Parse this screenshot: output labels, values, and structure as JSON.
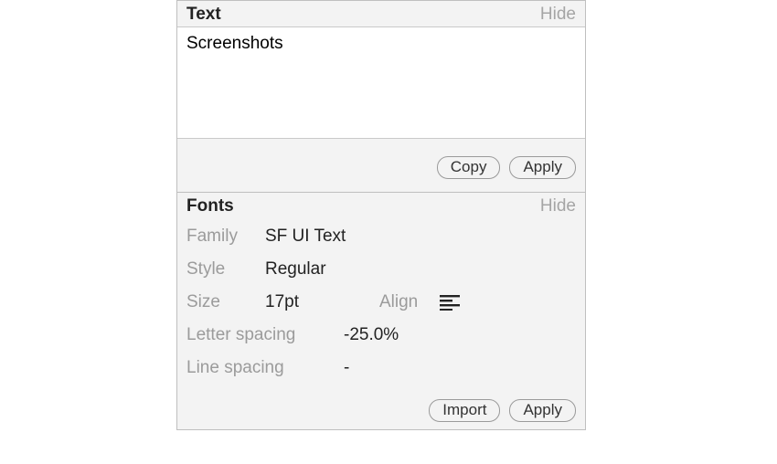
{
  "text_panel": {
    "title": "Text",
    "hide": "Hide",
    "value": "Screenshots",
    "copy_label": "Copy",
    "apply_label": "Apply"
  },
  "fonts_panel": {
    "title": "Fonts",
    "hide": "Hide",
    "family_label": "Family",
    "family_value": "SF UI Text",
    "style_label": "Style",
    "style_value": "Regular",
    "size_label": "Size",
    "size_value": "17pt",
    "align_label": "Align",
    "align_value": "left",
    "letter_spacing_label": "Letter spacing",
    "letter_spacing_value": "-25.0%",
    "line_spacing_label": "Line spacing",
    "line_spacing_value": "-",
    "import_label": "Import",
    "apply_label": "Apply"
  }
}
